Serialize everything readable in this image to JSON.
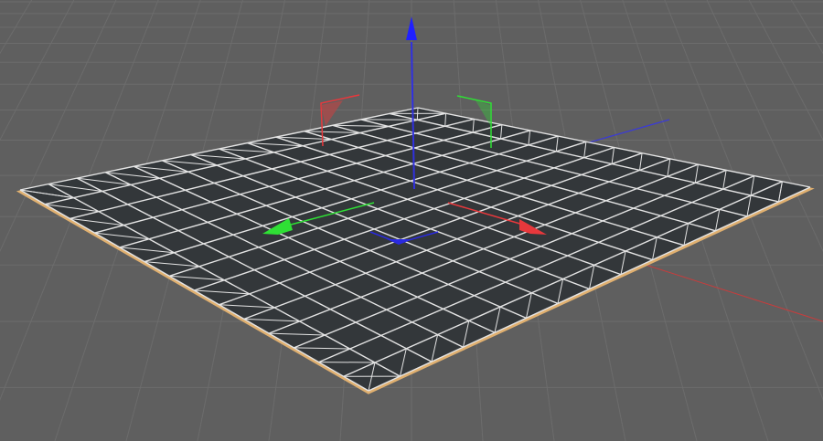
{
  "viewport": {
    "background_color": "#5f5f5f",
    "floor_grid_color": "#6c6c6c",
    "object": {
      "type": "plane",
      "face_color": "#33373a",
      "wire_color": "#e4e4e4",
      "edge_highlight_color": "#e0b070",
      "segments": 14
    },
    "colors": {
      "x_axis": "#e8383c",
      "y_axis": "#2fe035",
      "z_axis": "#2a2ae0",
      "up_axis": "#2020ff"
    },
    "icons": {
      "gizmo_up": "arrow-up-icon",
      "gizmo_x": "arrow-right-icon",
      "gizmo_y": "arrow-left-icon",
      "gizmo_z": "arrow-down-icon"
    }
  }
}
